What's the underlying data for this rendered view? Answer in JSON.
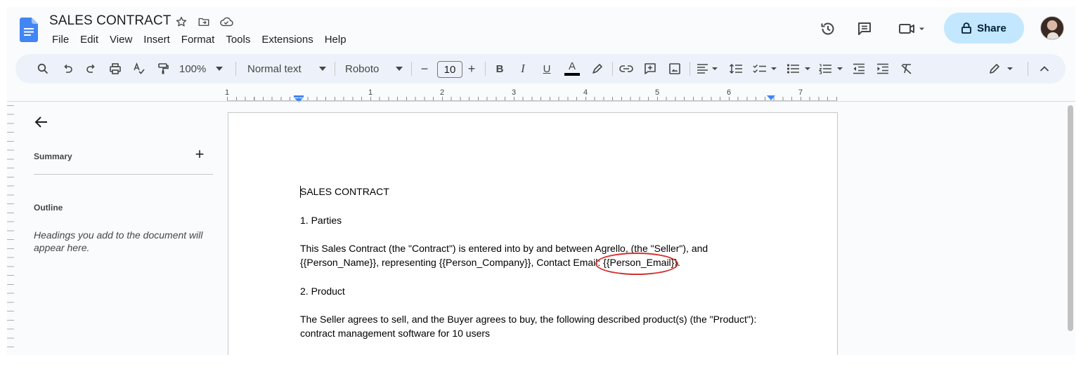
{
  "app": {
    "doc_title": "SALES CONTRACT",
    "menu": [
      "File",
      "Edit",
      "View",
      "Insert",
      "Format",
      "Tools",
      "Extensions",
      "Help"
    ],
    "share_label": "Share",
    "accent_color": "#c2e7ff",
    "logo_color": "#4285f4"
  },
  "toolbar": {
    "zoom": "100%",
    "style": "Normal text",
    "font": "Roboto",
    "font_size": "10",
    "minus": "−",
    "plus": "+",
    "bold": "B",
    "italic": "I",
    "underline": "U",
    "text_color": "A"
  },
  "ruler": {
    "numbers": [
      "1",
      "1",
      "2",
      "3",
      "4",
      "5",
      "6",
      "7"
    ]
  },
  "side_panel": {
    "summary_label": "Summary",
    "add_label": "+",
    "outline_label": "Outline",
    "outline_hint": "Headings you add to the document will appear here."
  },
  "document": {
    "title_line": "SALES CONTRACT",
    "section1_heading": "1. Parties",
    "para1_line1": "This Sales Contract (the \"Contract\") is entered into by and between Agrello, (the \"Seller\"), and",
    "para1_line2_before": "{{Person_Name}}, representing {{Person_Company}}, Contact Email: ",
    "para1_line2_highlight": "{{Person_Email}}",
    "para1_line2_after": ".",
    "section2_heading": "2. Product",
    "para2_line1": "The Seller agrees to sell, and the Buyer agrees to buy, the following described product(s) (the \"Product\"):",
    "para2_line2": "contract management software for 10 users",
    "highlight_color": "#d32f2f"
  }
}
